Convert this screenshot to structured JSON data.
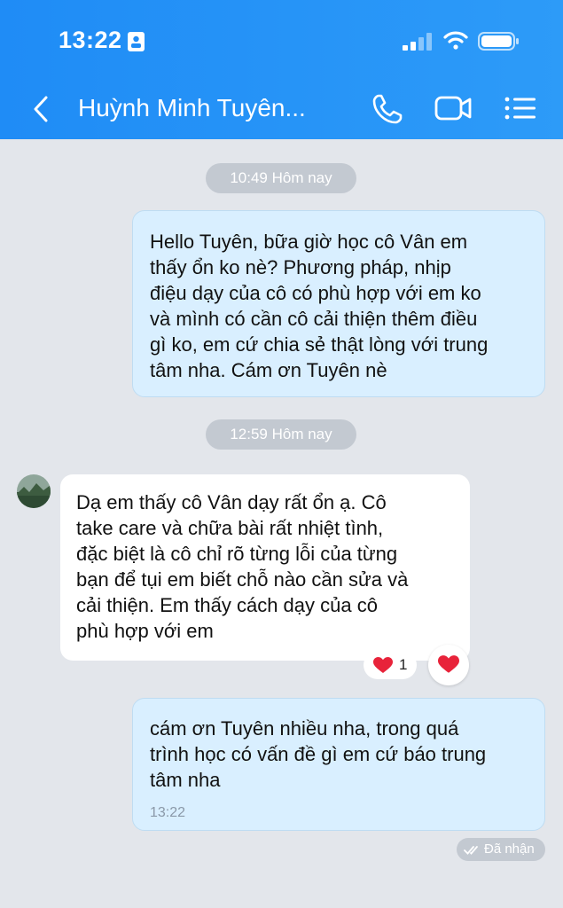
{
  "status_bar": {
    "time": "13:22"
  },
  "header": {
    "contact_name": "Huỳnh Minh Tuyên..."
  },
  "messages": [
    {
      "type": "timestamp",
      "text": "10:49 Hôm nay"
    },
    {
      "type": "outgoing",
      "lines": [
        "Hello Tuyên, bữa giờ học cô Vân em",
        "thấy ổn ko nè? Phương pháp, nhịp",
        "điệu dạy của cô có phù hợp với em ko",
        "và mình có cần cô cải thiện thêm điều",
        "gì ko, em cứ chia sẻ thật lòng với trung",
        "tâm nha. Cám ơn Tuyên nè"
      ]
    },
    {
      "type": "timestamp",
      "text": "12:59 Hôm nay"
    },
    {
      "type": "incoming",
      "lines": [
        "Dạ em thấy cô Vân dạy rất ổn ạ. Cô",
        "take care và chữa bài rất nhiệt tình,",
        "đặc biệt là cô chỉ rõ từng lỗi của từng",
        "bạn để tụi em biết chỗ nào cần sửa và",
        "cải thiện. Em thấy cách dạy của cô",
        "phù hợp với em"
      ],
      "reaction": {
        "icon": "heart-icon",
        "count": "1",
        "color": "#e8233a"
      }
    },
    {
      "type": "outgoing",
      "lines": [
        "cám ơn Tuyên nhiều nha, trong quá",
        "trình học có vấn đề gì em cứ báo trung",
        "tâm nha"
      ],
      "time": "13:22"
    }
  ],
  "delivery_status": "Đã nhận",
  "colors": {
    "header": "#1f8cf6",
    "outgoing_bubble": "#d9efff",
    "incoming_bubble": "#ffffff",
    "background": "#e3e6eb",
    "timestamp_pill": "#c3c9d1"
  }
}
